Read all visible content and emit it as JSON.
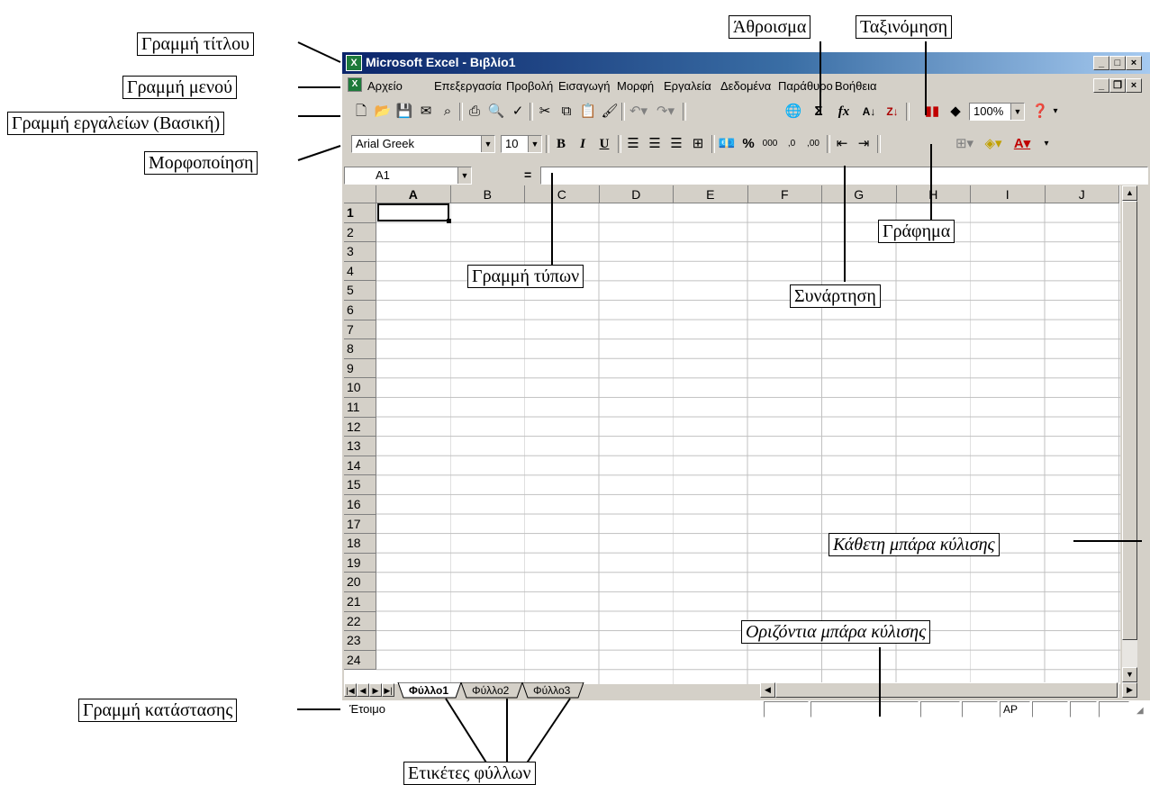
{
  "annotations": {
    "title_bar": "Γραμμή τίτλου",
    "menu_bar": "Γραμμή μενού",
    "standard_toolbar": "Γραμμή εργαλείων (Βασική)",
    "formatting": "Μορφοποίηση",
    "autosum": "Άθροισμα",
    "sort": "Ταξινόμηση",
    "chart": "Γράφημα",
    "formula_bar": "Γραμμή τύπων",
    "function": "Συνάρτηση",
    "vertical_scrollbar": "Κάθετη μπάρα κύλισης",
    "horizontal_scrollbar": "Οριζόντια μπάρα κύλισης",
    "status_bar": "Γραμμή κατάστασης",
    "sheet_tabs": "Ετικέτες φύλλων"
  },
  "window": {
    "title": "Microsoft Excel - Βιβλίο1",
    "icon": "excel-icon"
  },
  "menu": [
    "Αρχείο",
    "Επεξεργασία",
    "Προβολή",
    "Εισαγωγή",
    "Μορφή",
    "Εργαλεία",
    "Δεδομένα",
    "Παράθυρο",
    "Βοήθεια"
  ],
  "toolbar": {
    "zoom": "100%",
    "autosum_glyph": "Σ",
    "function_glyph": "fx"
  },
  "format": {
    "font": "Arial Greek",
    "size": "10",
    "bold": "B",
    "italic": "I",
    "underline": "U",
    "percent": "%",
    "thousands": "000",
    "inc_dec": ",0",
    "dec_dec": ",00"
  },
  "formula_bar": {
    "name_box": "A1",
    "equals": "="
  },
  "grid": {
    "columns": [
      "A",
      "B",
      "C",
      "D",
      "E",
      "F",
      "G",
      "H",
      "I",
      "J"
    ],
    "rows": [
      "1",
      "2",
      "3",
      "4",
      "5",
      "6",
      "7",
      "8",
      "9",
      "10",
      "11",
      "12",
      "13",
      "14",
      "15",
      "16",
      "17",
      "18",
      "19",
      "20",
      "21",
      "22",
      "23",
      "24"
    ],
    "active_cell": "A1"
  },
  "sheets": [
    "Φύλλο1",
    "Φύλλο2",
    "Φύλλο3"
  ],
  "status": {
    "text": "Έτοιμο",
    "caps": "ΑΡ"
  },
  "colors": {
    "title_start": "#0a246a",
    "title_end": "#a6caf0",
    "chrome": "#d4d0c8"
  }
}
